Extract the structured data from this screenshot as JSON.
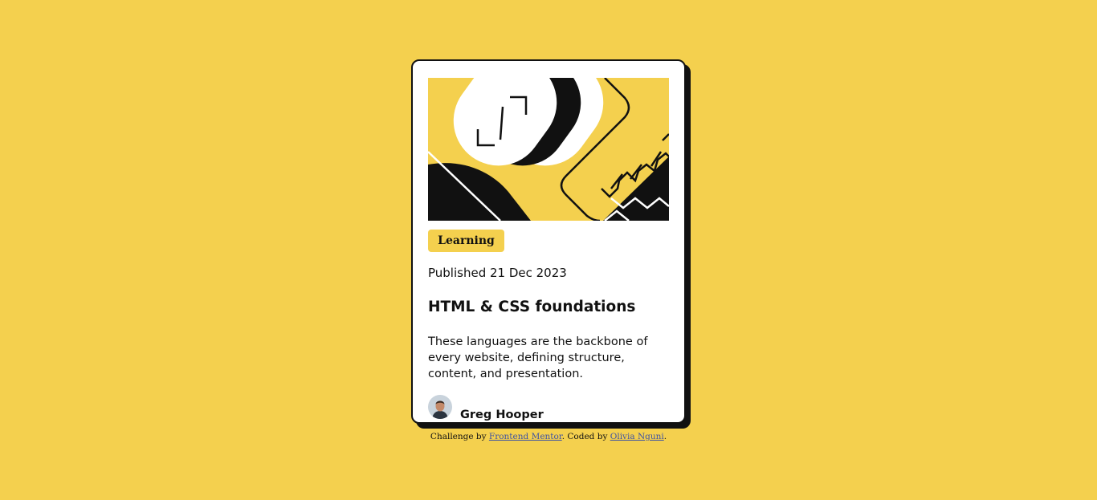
{
  "colors": {
    "background": "#f4d04e",
    "card": "#ffffff",
    "ink": "#111111",
    "link": "#3e52a3"
  },
  "card": {
    "illustration": "abstract-geometric-illustration",
    "category": "Learning",
    "published": "Published 21 Dec 2023",
    "title": "HTML & CSS foundations",
    "description": "These languages are the backbone of every website, defining structure, content, and presentation.",
    "author": {
      "avatar": "avatar-image",
      "name": "Greg Hooper"
    }
  },
  "attribution": {
    "prefix": "Challenge by ",
    "challenge_link": "Frontend Mentor",
    "middle": ". Coded by ",
    "author_link": "Olivia Nguni",
    "suffix": "."
  }
}
